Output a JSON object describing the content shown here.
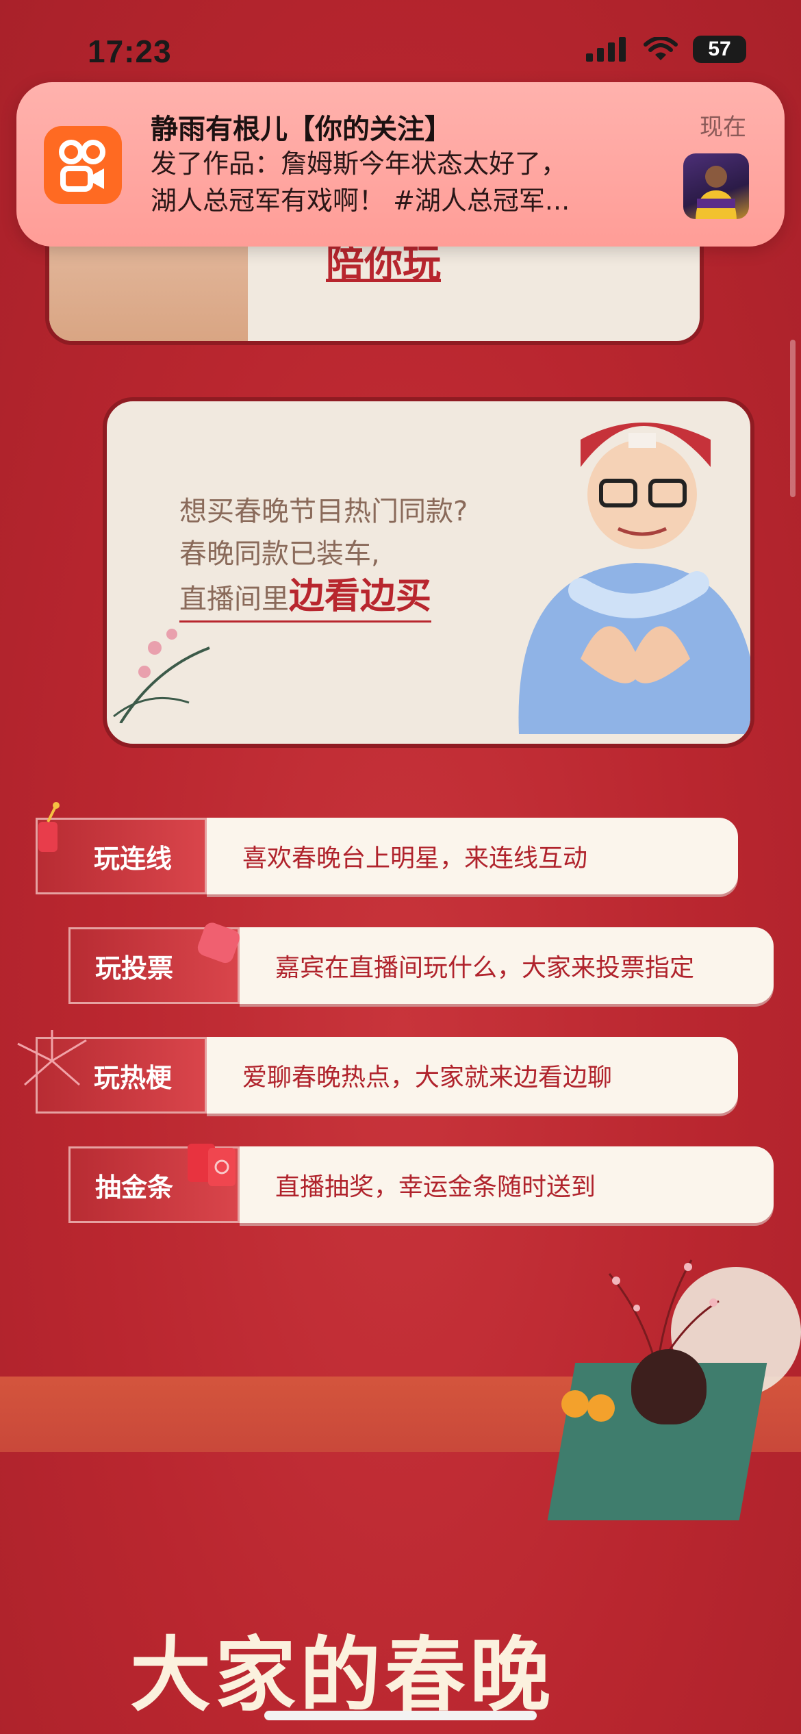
{
  "status_bar": {
    "time": "17:23",
    "battery": "57"
  },
  "notification": {
    "title": "静雨有根儿【你的关注】",
    "time": "现在",
    "body_line1": "发了作品：詹姆斯今年状态太好了，",
    "body_line2": "湖人总冠军有戏啊！ #湖人总冠军..."
  },
  "top_card": {
    "caption": "陪你玩"
  },
  "mid_card": {
    "line1": "想买春晚节目热门同款?",
    "line2": "春晚同款已装车,",
    "line3_prefix": "直播间里",
    "line3_highlight": "边看边买"
  },
  "features": [
    {
      "tag": "玩连线",
      "desc": "喜欢春晚台上明星，来连线互动"
    },
    {
      "tag": "玩投票",
      "desc": "嘉宾在直播间玩什么，大家来投票指定"
    },
    {
      "tag": "玩热梗",
      "desc": "爱聊春晚热点，大家就来边看边聊"
    },
    {
      "tag": "抽金条",
      "desc": "直播抽奖，幸运金条随时送到"
    }
  ],
  "bottom": {
    "title": "大家的春晚"
  }
}
